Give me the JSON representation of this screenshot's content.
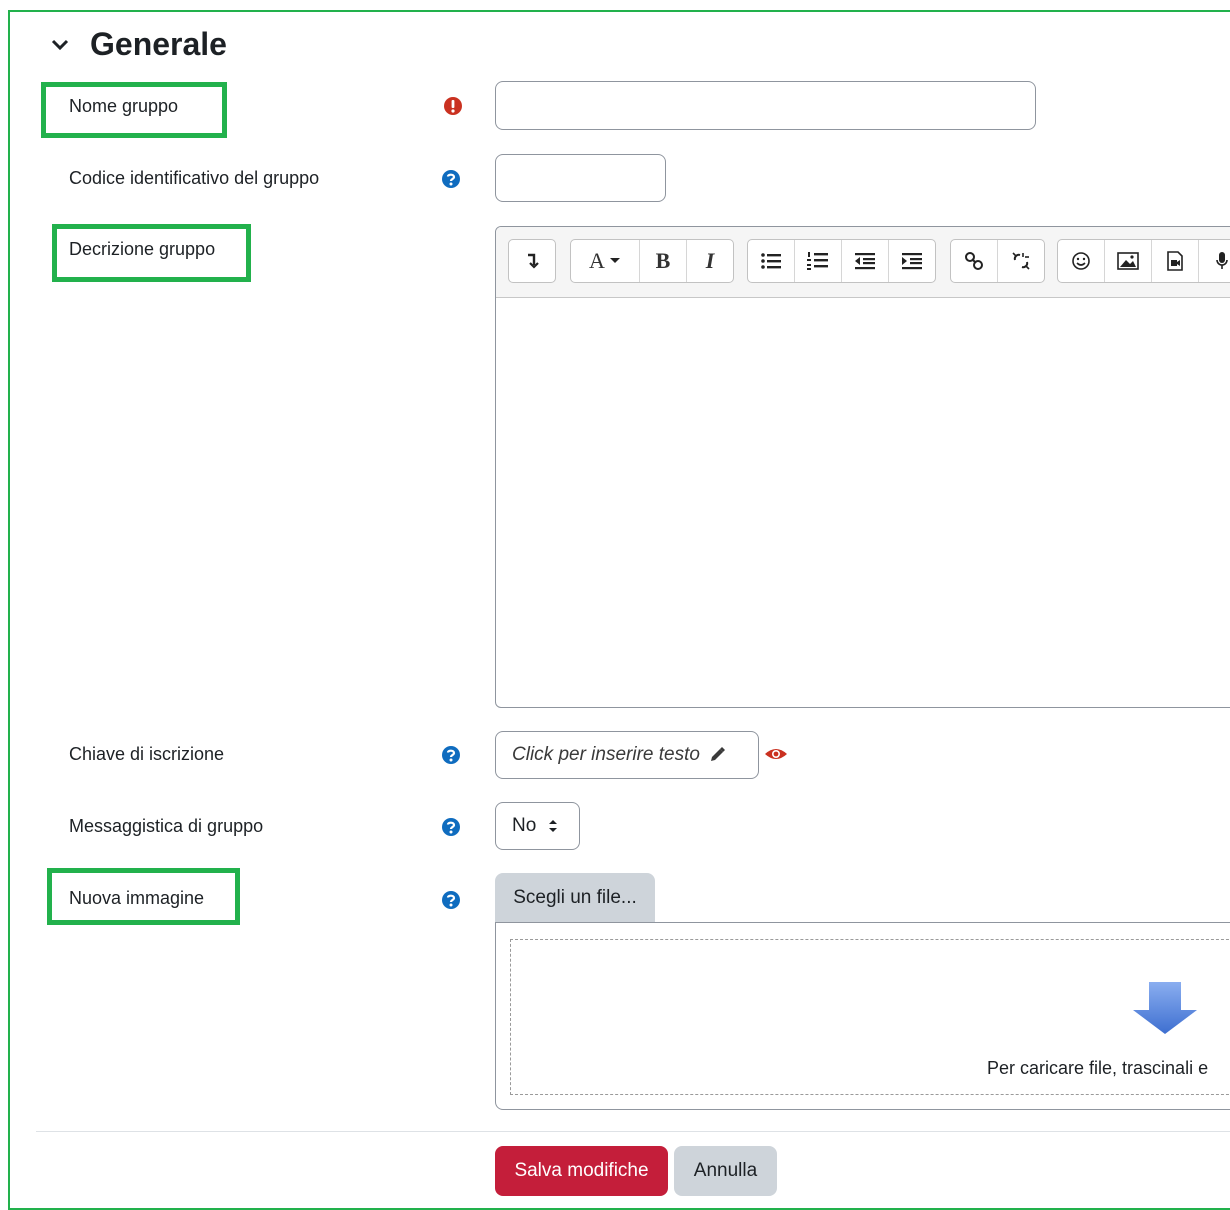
{
  "section": {
    "title": "Generale",
    "collapse_icon": "chevron-down-icon"
  },
  "fields": {
    "group_name": {
      "label": "Nome gruppo",
      "indicator_icon": "required-exclamation-icon",
      "value": "",
      "placeholder": ""
    },
    "group_id": {
      "label": "Codice identificativo del gruppo",
      "indicator_icon": "help-icon",
      "value": "",
      "placeholder": ""
    },
    "group_description": {
      "label": "Decrizione gruppo",
      "toolbar_icons": [
        "toolbar-toggle-icon",
        "font-style-dropdown-icon",
        "bold-icon",
        "italic-icon",
        "unordered-list-icon",
        "ordered-list-icon",
        "outdent-icon",
        "indent-icon",
        "link-icon",
        "unlink-icon",
        "emoji-icon",
        "image-icon",
        "media-icon",
        "record-audio-icon"
      ],
      "toolbar_labels": {
        "font": "A",
        "bold": "B",
        "italic": "I"
      }
    },
    "enrolment_key": {
      "label": "Chiave di iscrizione",
      "indicator_icon": "help-icon",
      "placeholder": "Click per inserire testo",
      "reveal_icon": "eye-icon",
      "edit_icon": "pencil-icon"
    },
    "group_messaging": {
      "label": "Messaggistica di gruppo",
      "indicator_icon": "help-icon",
      "selected": "No"
    },
    "new_picture": {
      "label": "Nuova immagine",
      "indicator_icon": "help-icon",
      "choose_label": "Scegli un file...",
      "drop_text": "Per caricare file, trascinali e",
      "drop_icon": "arrow-down-icon"
    }
  },
  "actions": {
    "save_label": "Salva modifiche",
    "cancel_label": "Annulla"
  },
  "colors": {
    "highlight": "#22b14c",
    "required": "#ca3120",
    "help": "#0f6cbf",
    "primary": "#c41e3a",
    "secondary": "#ced4da"
  }
}
